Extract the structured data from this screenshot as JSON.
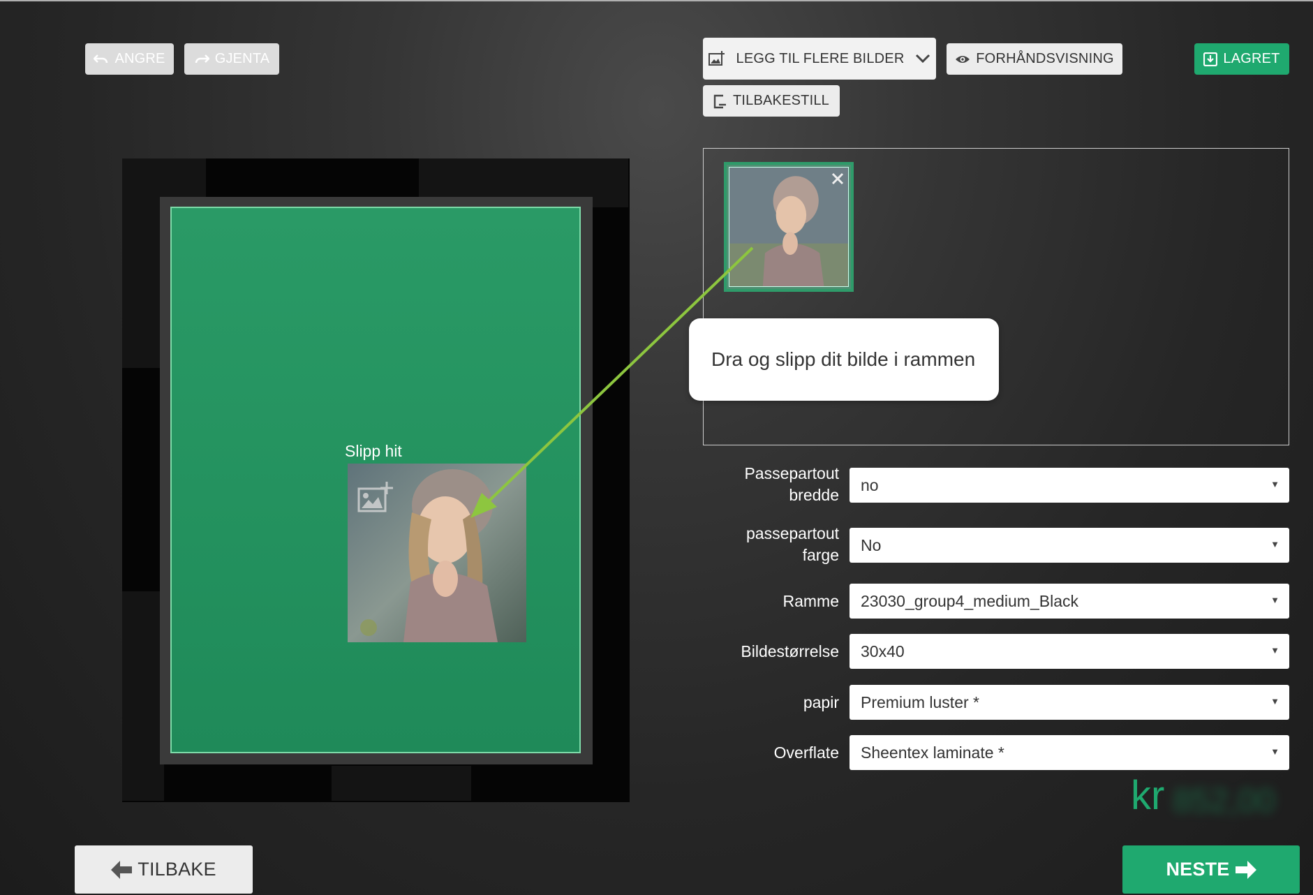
{
  "toolbar": {
    "undo_label": "ANGRE",
    "redo_label": "GJENTA",
    "add_images_label": "LEGG TIL FLERE BILDER",
    "preview_label": "FORHÅNDSVISNING",
    "saved_label": "LAGRET",
    "reset_label": "TILBAKESTILL"
  },
  "canvas": {
    "drop_label": "Slipp hit"
  },
  "panel": {
    "tooltip": "Dra og slipp dit bilde i rammen"
  },
  "form": {
    "mat_width_label_1": "Passepartout",
    "mat_width_label_2": "bredde",
    "mat_width_value": "no",
    "mat_color_label_1": "passepartout",
    "mat_color_label_2": "farge",
    "mat_color_value": "No",
    "frame_label": "Ramme",
    "frame_value": "23030_group4_medium_Black",
    "size_label": "Bildestørrelse",
    "size_value": "30x40",
    "paper_label": "papir",
    "paper_value": "Premium luster *",
    "surface_label": "Overflate",
    "surface_value": "Sheentex laminate *"
  },
  "price": {
    "currency": "kr",
    "value": "852,00"
  },
  "nav": {
    "back_label": "TILBAKE",
    "next_label": "NESTE"
  },
  "colors": {
    "accent_green": "#1fa96f",
    "mat_green": "#23915e",
    "arrow_green": "#8dc63f"
  }
}
